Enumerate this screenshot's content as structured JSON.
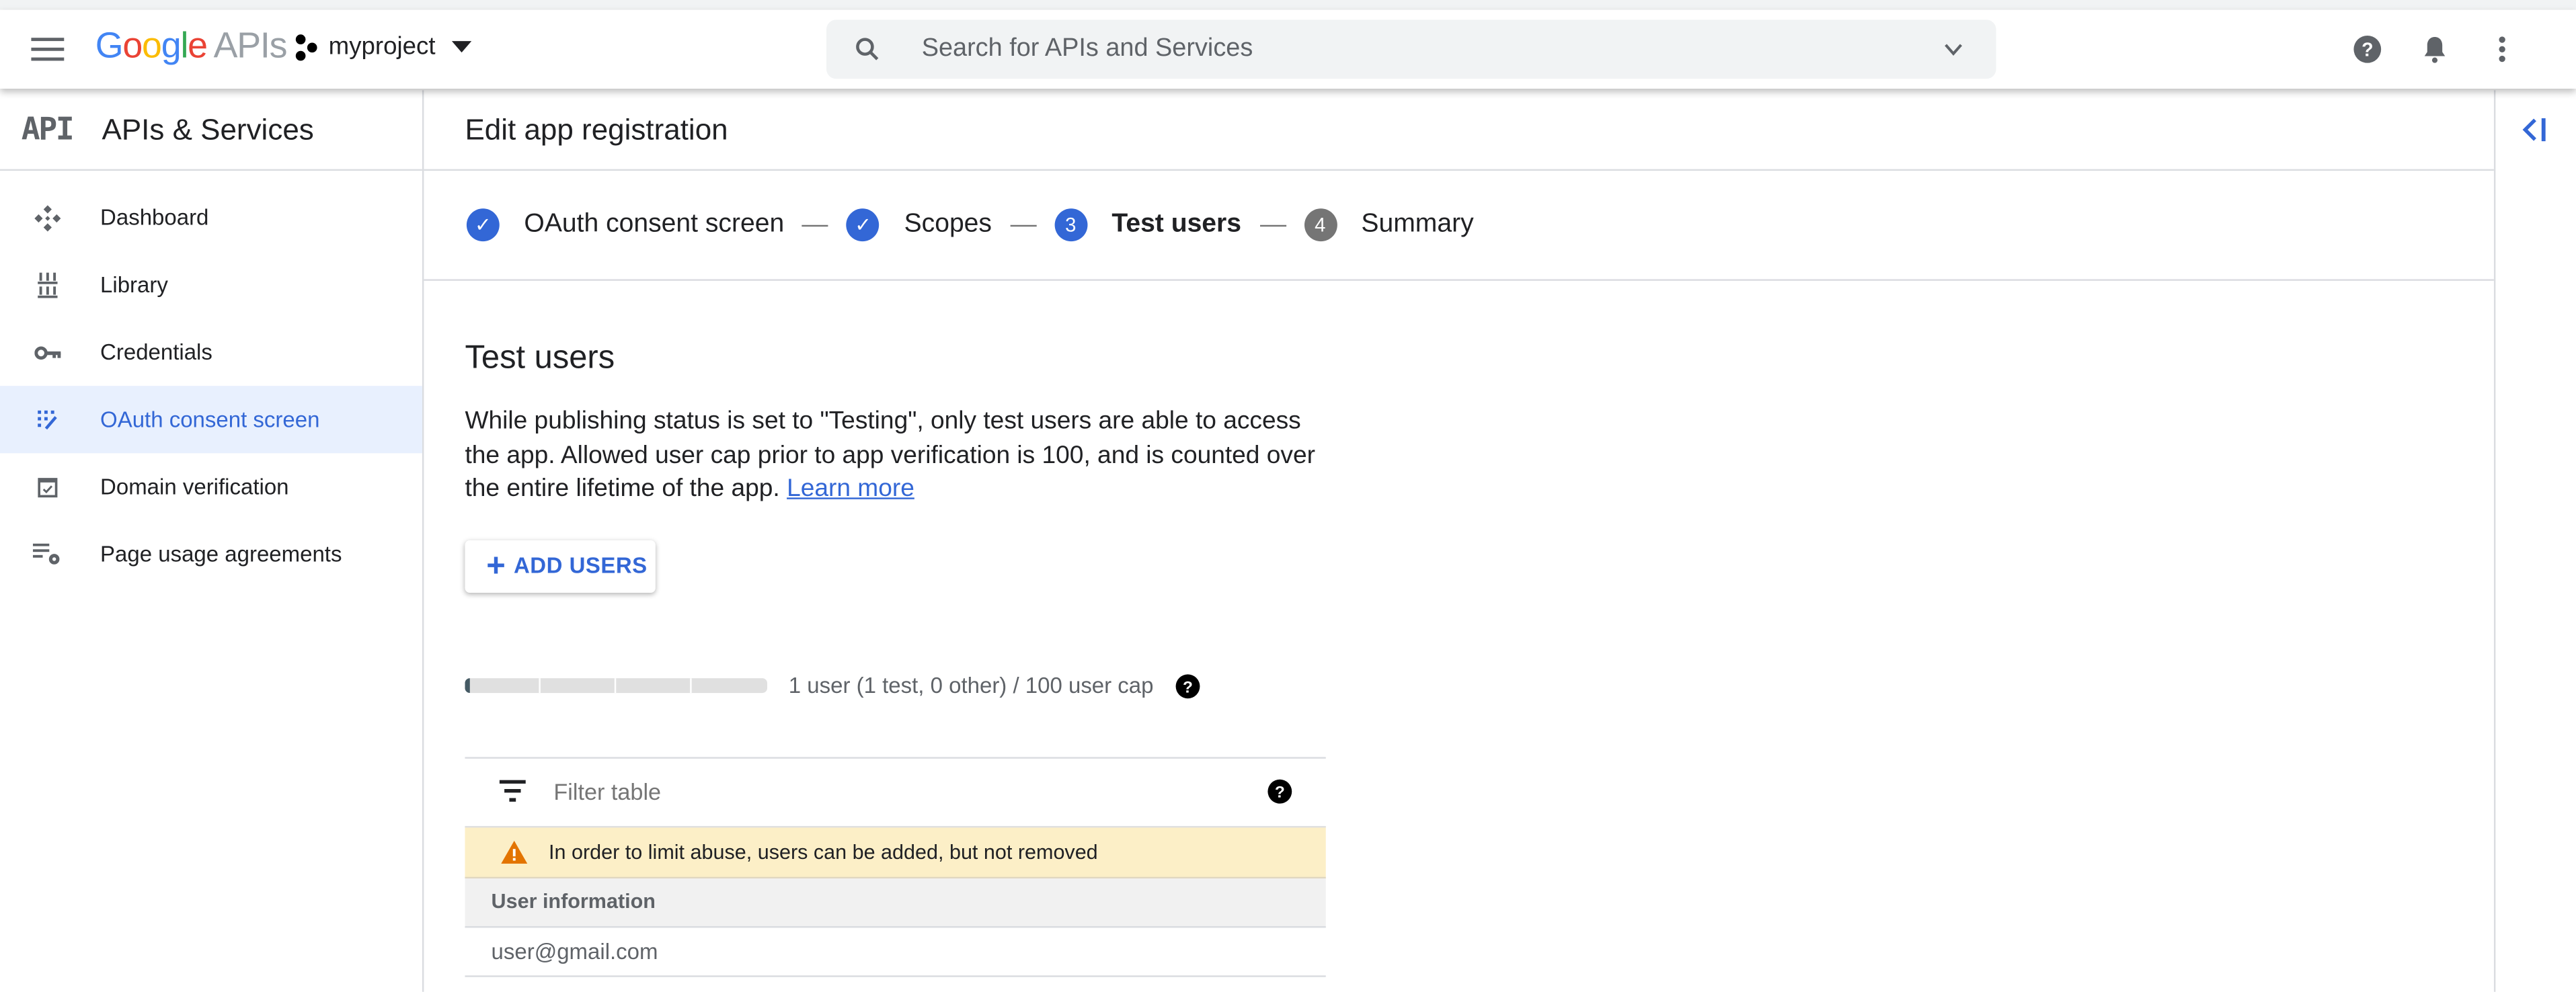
{
  "appbar": {
    "logo_google": [
      "G",
      "o",
      "o",
      "g",
      "l",
      "e"
    ],
    "logo_suffix": "APIs",
    "project_name": "myproject",
    "search_placeholder": "Search for APIs and Services",
    "icons": [
      "menu-icon",
      "help-icon",
      "notifications-bell-icon",
      "more-vert-icon"
    ]
  },
  "sidebar": {
    "logo_text": "API",
    "title": "APIs & Services",
    "items": [
      {
        "label": "Dashboard",
        "icon": "dashboard-icon",
        "active": false
      },
      {
        "label": "Library",
        "icon": "library-icon",
        "active": false
      },
      {
        "label": "Credentials",
        "icon": "key-icon",
        "active": false
      },
      {
        "label": "OAuth consent screen",
        "icon": "consent-screen-icon",
        "active": true
      },
      {
        "label": "Domain verification",
        "icon": "domain-check-icon",
        "active": false
      },
      {
        "label": "Page usage agreements",
        "icon": "list-settings-icon",
        "active": false
      }
    ]
  },
  "page": {
    "title": "Edit app registration",
    "steps": [
      {
        "label": "OAuth consent screen",
        "marker": "✓",
        "status": "done"
      },
      {
        "label": "Scopes",
        "marker": "✓",
        "status": "done"
      },
      {
        "label": "Test users",
        "marker": "3",
        "status": "current"
      },
      {
        "label": "Summary",
        "marker": "4",
        "status": "todo"
      }
    ],
    "section_title": "Test users",
    "description": "While publishing status is set to \"Testing\", only test users are able to access the app. Allowed user cap prior to app verification is 100, and is counted over the entire lifetime of the app.",
    "learn_more": "Learn more",
    "add_users_label": "ADD USERS",
    "user_cap": {
      "used": 1,
      "cap": 100,
      "fill_fraction": 0.01,
      "text": "1 user (1 test, 0 other) / 100 user cap"
    },
    "table": {
      "filter_placeholder": "Filter table",
      "warning": "In order to limit abuse, users can be added, but not removed",
      "column_header": "User information",
      "rows": [
        "user@gmail.com"
      ]
    }
  },
  "colors": {
    "accent": "#3367d6",
    "active_bg": "#e8f0fe",
    "warning_bg": "#fcefc7",
    "warning_icon": "#e37400"
  }
}
